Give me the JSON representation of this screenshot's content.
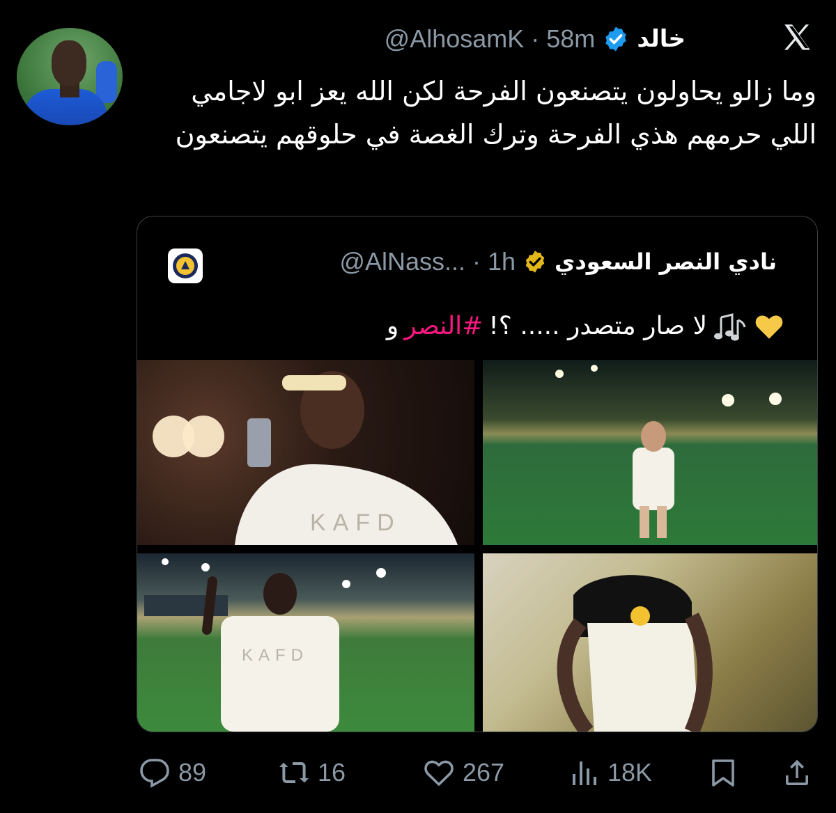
{
  "tweet": {
    "author_name": "خالد",
    "handle_time": "@AlhosamK · 58m",
    "text": "وما زالو يحاولون يتصنعون الفرحة لكن الله يعز ابو لاجامي اللي حرمهم هذي الفرحة وترك الغصة في حلوقهم يتصنعون",
    "verified_color": "#1d9bf0"
  },
  "quote": {
    "name": "نادي النصر السعودي",
    "handle_time": "@AlNass... · 1h",
    "text_prefix": "و",
    "hashtag": "#النصر",
    "text_rest": "لا صار متصدر ..... ؟!",
    "verified_color": "#e2b719",
    "hashtag_color": "#f91880",
    "photos": [
      "photo-1",
      "photo-2",
      "photo-3",
      "photo-4"
    ]
  },
  "actions": {
    "replies": "89",
    "reposts": "16",
    "likes": "267",
    "views": "18K"
  },
  "icons": [
    "x-logo-icon",
    "verified-badge-icon",
    "gold-verified-badge-icon",
    "music-notes-icon",
    "yellow-heart-icon",
    "reply-icon",
    "repost-icon",
    "like-icon",
    "views-icon",
    "bookmark-icon",
    "share-icon"
  ]
}
